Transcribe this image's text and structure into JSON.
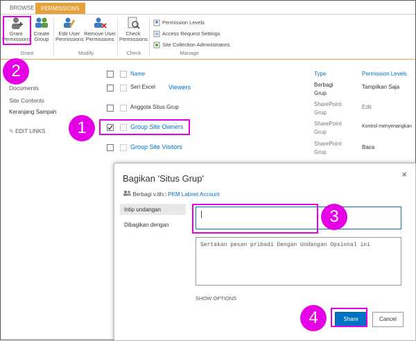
{
  "ribbon": {
    "tabs": [
      "BROWSE",
      "PERMISSIONS"
    ],
    "grant_permissions": "Grant Permissions",
    "create_group": "Create Group",
    "edit_user_permissions": "Edit User Permissions",
    "remove_user_permissions": "Remove User Permissions",
    "check_permissions": "Check Permissions",
    "permission_levels": "Permission Levels",
    "access_request_settings": "Access Request Settings",
    "site_collection_admins": "Site Collection Administrators",
    "groups": {
      "grant": "Grant",
      "modify": "Modify",
      "check": "Check",
      "manage": "Manage"
    }
  },
  "nav": {
    "documents": "Documents",
    "site_contents": "Site Contents",
    "recycle_bin": "Keranjang Sampah",
    "edit_links": "EDIT LINKS"
  },
  "table": {
    "headers": {
      "name": "Name",
      "type": "Type",
      "permission_levels": "Permission Levels"
    },
    "rows": [
      {
        "name": "Seri Excel",
        "extra": "Viewers",
        "type": "Berbagi Grup",
        "perm": "Tampilkan Saja",
        "checked": false
      },
      {
        "name": "Anggota Situs Grup",
        "type": "SharePoint Grup",
        "perm": "Edit",
        "checked": false
      },
      {
        "name": "Group Site Owners",
        "type": "SharePoint Grup",
        "perm": "Kontrol menyenangkan",
        "checked": true
      },
      {
        "name": "Group Site Visitors",
        "type": "SharePoint Grup",
        "perm": "Baca",
        "checked": false
      }
    ]
  },
  "dialog": {
    "title": "Bagikan 'Situs Grup'",
    "close": "×",
    "shared_by": "Berbagi v.ith□",
    "shared_account": "PKM Labnet Account",
    "tab_invite": "Intip undangan",
    "tab_shared_with": "Dibagikan dengan",
    "invite_value": "|",
    "message": "Sertakan pesan pribadi Dengan Undangan Opsional ini",
    "show_options": "SHOW OPTIONS",
    "share": "Share",
    "cancel": "Cancel"
  },
  "callouts": [
    "1",
    "2",
    "3",
    "4"
  ],
  "colors": {
    "accent": "#e6a13a",
    "link": "#0072c6",
    "callout": "#e600e6"
  }
}
